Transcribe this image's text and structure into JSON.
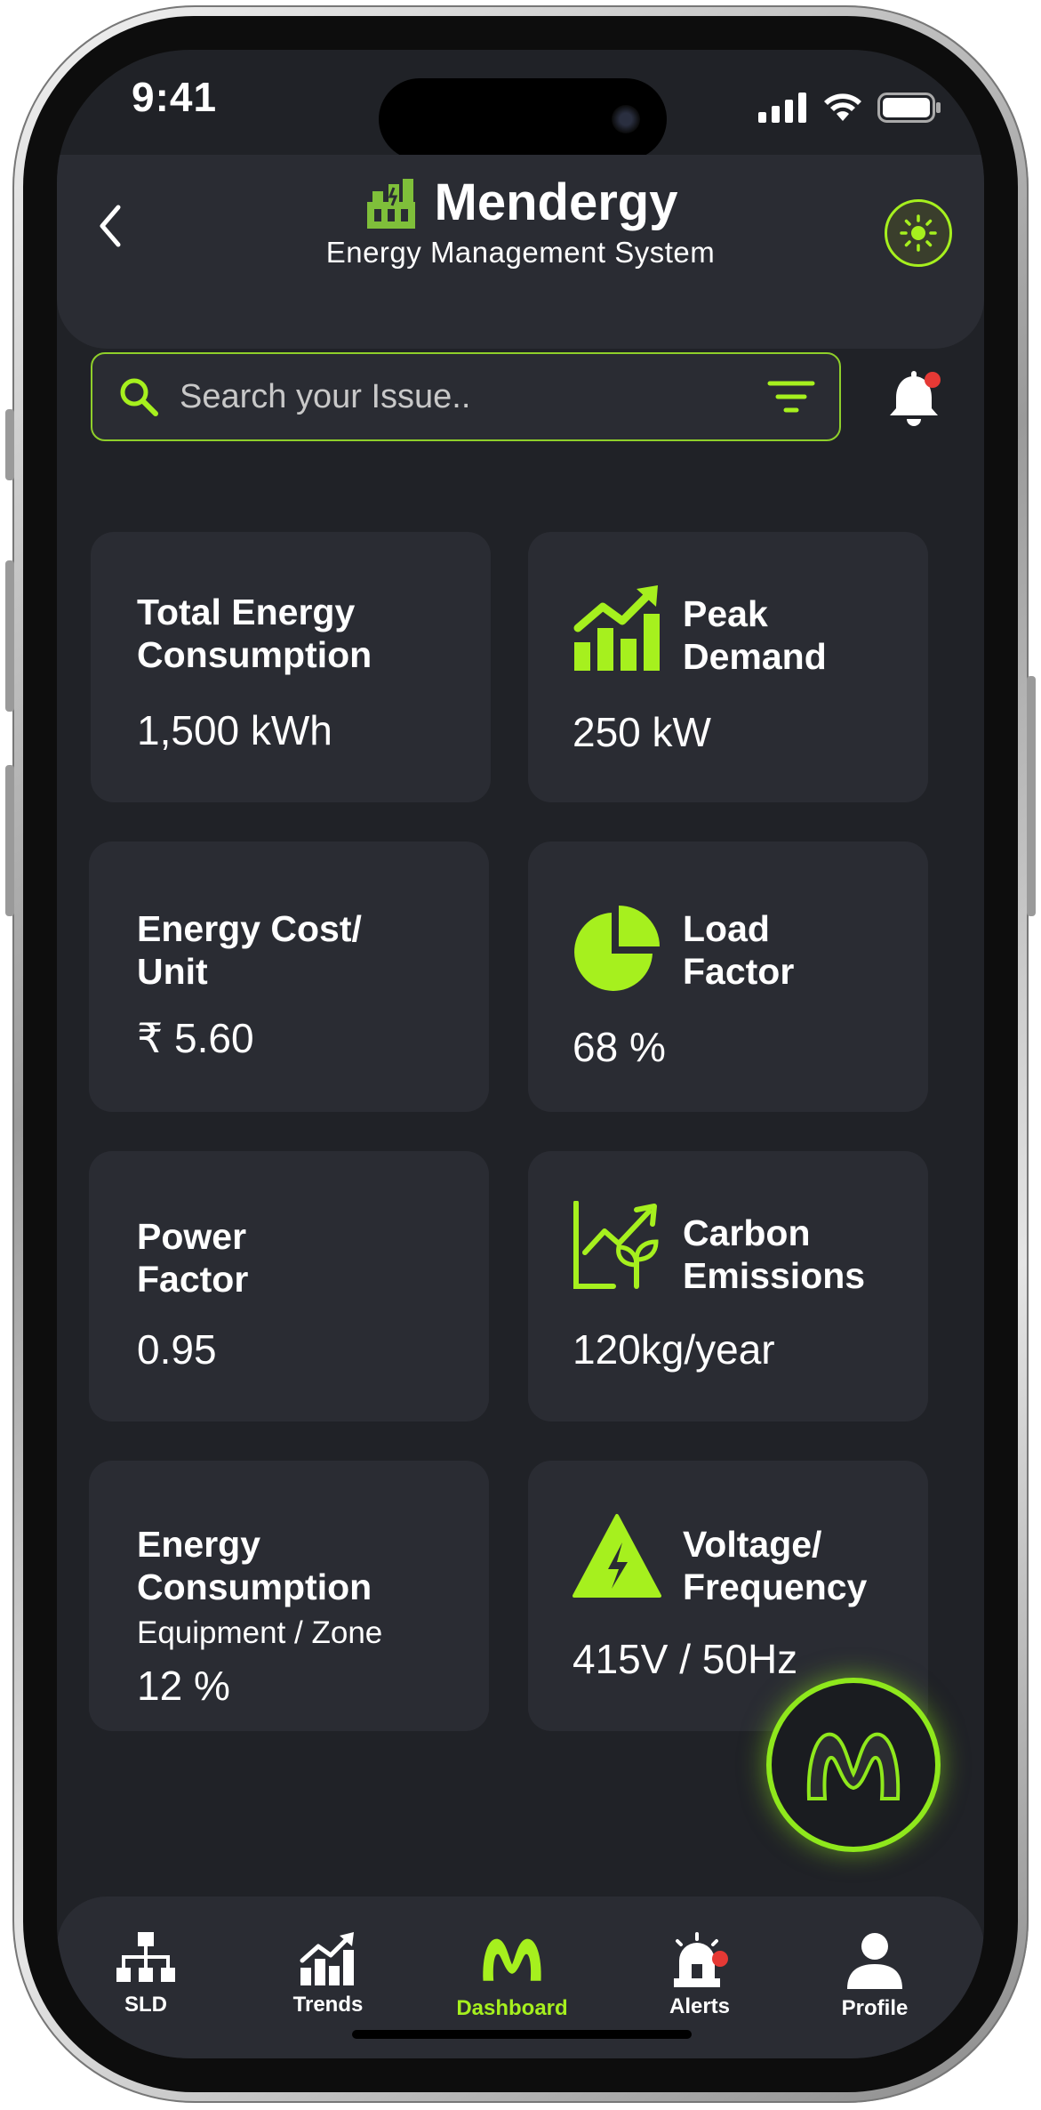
{
  "status_bar": {
    "time": "9:41"
  },
  "header": {
    "app_name": "Mendergy",
    "subtitle": "Energy Management System"
  },
  "search": {
    "placeholder": "Search your Issue.."
  },
  "cards": [
    {
      "title": "Total Energy\nConsumption",
      "value": "1,500 kWh",
      "icon": "none"
    },
    {
      "title": "Peak\nDemand",
      "value": "250 kW",
      "icon": "bar-chart-trend-icon"
    },
    {
      "title": "Energy Cost/\nUnit",
      "value": "₹ 5.60",
      "icon": "none"
    },
    {
      "title": "Load\nFactor",
      "value": "68 %",
      "icon": "pie-chart-icon"
    },
    {
      "title": "Power\nFactor",
      "value": "0.95",
      "icon": "none"
    },
    {
      "title": "Carbon\nEmissions",
      "value": "120kg/year",
      "icon": "chart-leaf-icon"
    },
    {
      "title": "Energy\nConsumption",
      "subtitle": "Equipment / Zone",
      "value": "12 %",
      "icon": "none"
    },
    {
      "title": "Voltage/\nFrequency",
      "value": "415V / 50Hz",
      "icon": "high-voltage-icon"
    }
  ],
  "bottom_nav": [
    {
      "label": "SLD",
      "icon": "network-tree-icon",
      "active": false
    },
    {
      "label": "Trends",
      "icon": "trend-chart-icon",
      "active": false
    },
    {
      "label": "Dashboard",
      "icon": "m-logo-icon",
      "active": true
    },
    {
      "label": "Alerts",
      "icon": "siren-icon",
      "active": false
    },
    {
      "label": "Profile",
      "icon": "user-icon",
      "active": false
    }
  ],
  "colors": {
    "accent": "#a6f01e",
    "background": "#202227",
    "card": "#2a2c33",
    "alert_dot": "#e53935"
  }
}
